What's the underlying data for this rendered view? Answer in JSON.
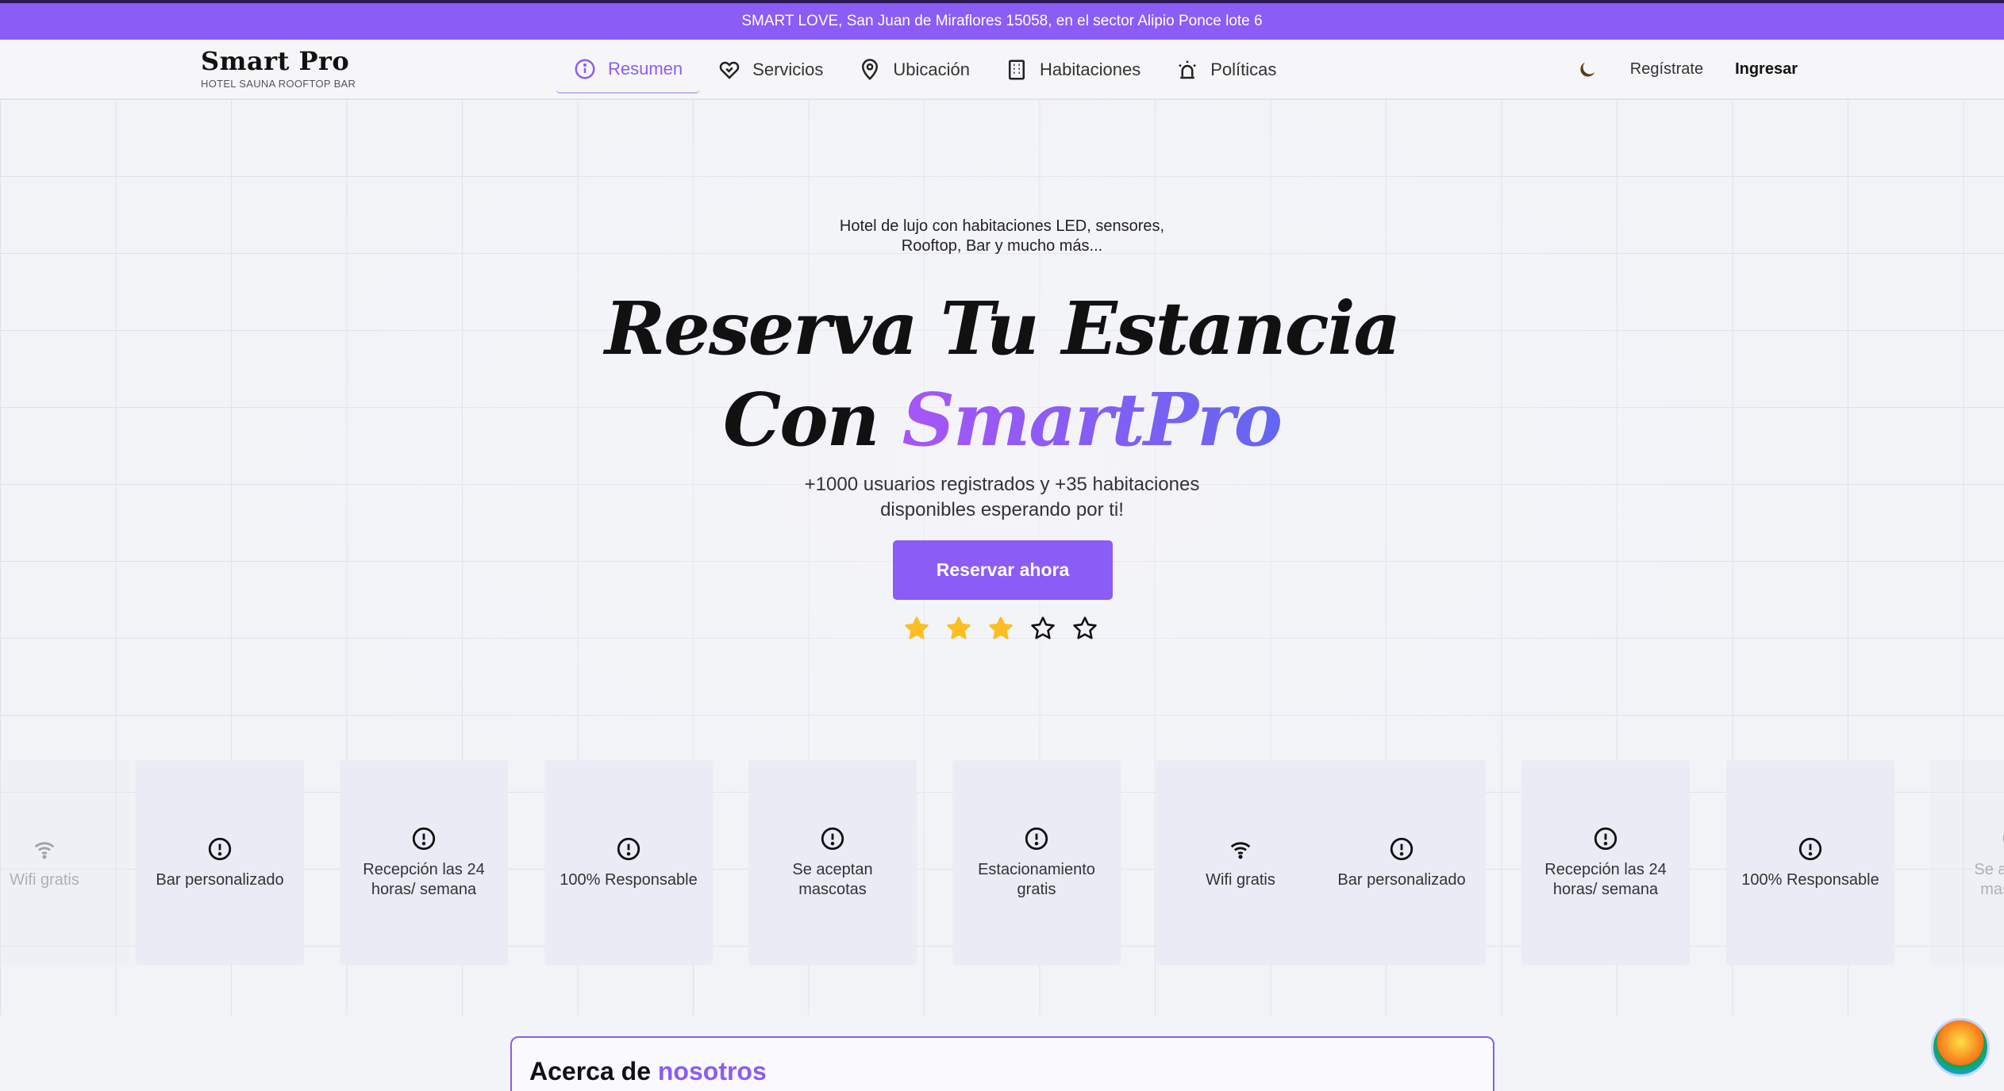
{
  "topbar": {
    "text": "SMART LOVE, San Juan de Miraflores 15058, en el sector Alipio Ponce lote 6"
  },
  "brand": {
    "name": "Smart Pro",
    "subtitle": "HOTEL SAUNA ROOFTOP BAR"
  },
  "nav": {
    "items": [
      {
        "label": "Resumen",
        "icon": "info-icon",
        "active": true
      },
      {
        "label": "Servicios",
        "icon": "heart-handshake-icon",
        "active": false
      },
      {
        "label": "Ubicación",
        "icon": "map-pin-icon",
        "active": false
      },
      {
        "label": "Habitaciones",
        "icon": "building-icon",
        "active": false
      },
      {
        "label": "Políticas",
        "icon": "alarm-siren-icon",
        "active": false
      }
    ],
    "theme_icon": "moon-icon",
    "register": "Regístrate",
    "login": "Ingresar"
  },
  "hero": {
    "tagline_line1": "Hotel de lujo con habitaciones LED, sensores,",
    "tagline_line2": "Rooftop, Bar y mucho más...",
    "headline_line1": "Reserva Tu Estancia",
    "headline_line2_prefix": "Con ",
    "headline_line2_accent": "SmartPro",
    "subtext_line1": "+1000 usuarios registrados y +35 habitaciones",
    "subtext_line2": "disponibles esperando por ti!",
    "cta": "Reservar ahora",
    "rating": {
      "filled": 3,
      "total": 5,
      "star_color": "#fbbf24"
    }
  },
  "features": [
    {
      "label": "Wifi gratis",
      "icon": "wifi-icon"
    },
    {
      "label": "Bar personalizado",
      "icon": "alert-circle-icon"
    },
    {
      "label": "Recepción las 24 horas/ semana",
      "icon": "alert-circle-icon"
    },
    {
      "label": "100% Responsable",
      "icon": "alert-circle-icon"
    },
    {
      "label": "Se aceptan mascotas",
      "icon": "alert-circle-icon"
    },
    {
      "label": "Estacionamiento gratis",
      "icon": "alert-circle-icon"
    },
    {
      "label": "Wifi gratis",
      "icon": "wifi-icon"
    },
    {
      "label": "Bar personalizado",
      "icon": "alert-circle-icon"
    },
    {
      "label": "Recepción las 24 horas/ semana",
      "icon": "alert-circle-icon"
    },
    {
      "label": "100% Responsable",
      "icon": "alert-circle-icon"
    },
    {
      "label": "Se aceptan mascotas",
      "icon": "alert-circle-icon"
    }
  ],
  "about": {
    "title_prefix": "Acerca de ",
    "title_accent": "nosotros"
  },
  "colors": {
    "accent": "#8b5cf6",
    "topbar": "#8b5cf6"
  }
}
